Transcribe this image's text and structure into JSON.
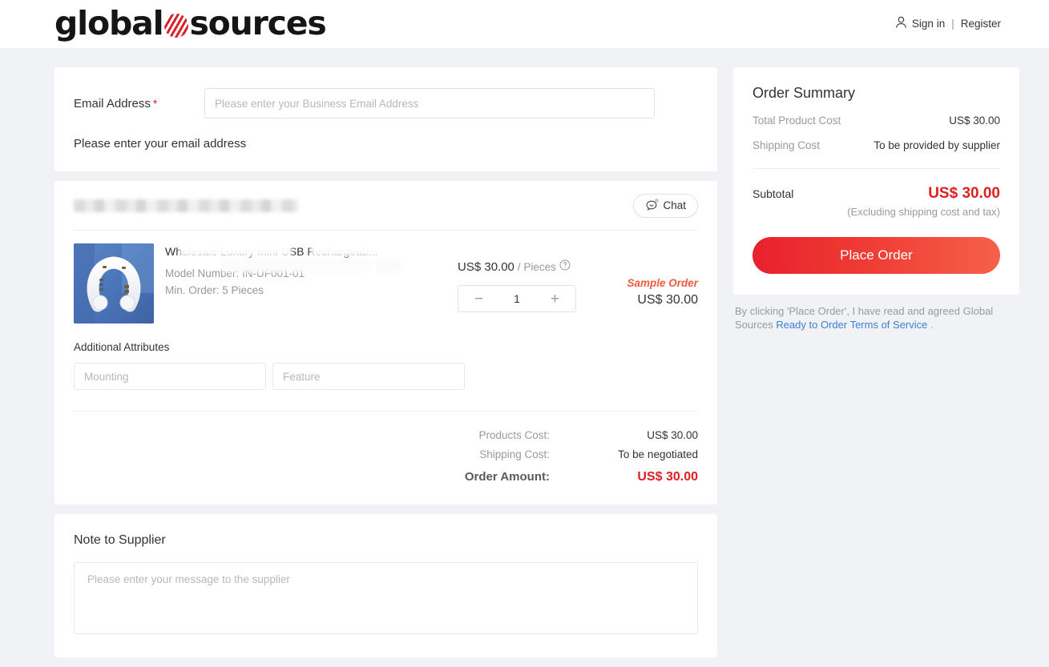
{
  "header": {
    "logo": {
      "word1": "global",
      "word2": "sources",
      "mark": "striped-sphere"
    },
    "sign_in": "Sign in",
    "separator": "|",
    "register": "Register"
  },
  "email_section": {
    "label": "Email Address",
    "required_marker": "*",
    "placeholder": "Please enter your Business Email Address",
    "value": "",
    "hint": "Please enter your email address"
  },
  "supplier_section": {
    "supplier_name_redacted": "",
    "chat_label": "Chat",
    "product": {
      "title": "Wholesale Luxury Mini USB Rechargeab...",
      "model_label": "Model Number: IN-UF001-01",
      "min_order_label": "Min. Order: 5 Pieces",
      "unit_price": "US$ 30.00",
      "unit_suffix": "/ Pieces",
      "help_icon": "question-circle-icon",
      "quantity": "1",
      "decrease_label": "−",
      "increase_label": "+",
      "sample_tag": "Sample Order",
      "sample_amount": "US$ 30.00"
    },
    "attributes": {
      "title": "Additional Attributes",
      "fields": [
        {
          "placeholder": "Mounting",
          "value": ""
        },
        {
          "placeholder": "Feature",
          "value": ""
        }
      ]
    },
    "totals": [
      {
        "label": "Products Cost:",
        "value": "US$ 30.00"
      },
      {
        "label": "Shipping Cost:",
        "value": "To be negotiated"
      }
    ],
    "order_amount": {
      "label": "Order Amount:",
      "value": "US$ 30.00"
    }
  },
  "note_section": {
    "title": "Note to Supplier",
    "placeholder": "Please enter your message to the supplier",
    "value": ""
  },
  "order_summary": {
    "title": "Order Summary",
    "rows": [
      {
        "label": "Total Product Cost",
        "value": "US$ 30.00"
      },
      {
        "label": "Shipping Cost",
        "value": "To be provided by supplier"
      }
    ],
    "subtotal_label": "Subtotal",
    "subtotal_value": "US$ 30.00",
    "excluding_note": "(Excluding shipping cost and tax)",
    "place_order_label": "Place Order",
    "terms_prefix": "By clicking 'Place Order', I have read and agreed Global Sources ",
    "terms_link": "Ready to Order Terms of Service",
    "terms_suffix": " ."
  },
  "colors": {
    "page_background": "#f0f2f5",
    "card_background": "#ffffff",
    "accent_red": "#e02020",
    "brand_red": "#d8232a",
    "link_blue": "#3b7fd4",
    "sample_orange": "#f05a43",
    "muted_text": "#9a9a9a"
  }
}
